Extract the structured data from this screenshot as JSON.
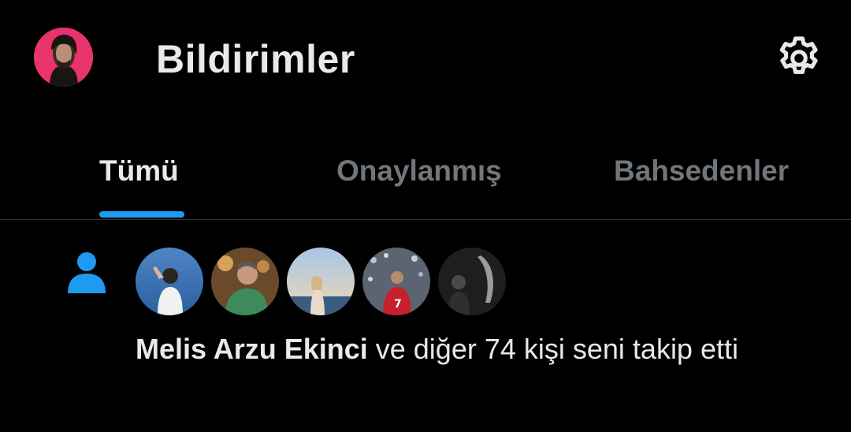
{
  "header": {
    "title": "Bildirimler",
    "avatar_icon": "profile-avatar",
    "settings_icon": "gear-icon"
  },
  "tabs": [
    {
      "label": "Tümü",
      "active": true
    },
    {
      "label": "Onaylanmış",
      "active": false
    },
    {
      "label": "Bahsedenler",
      "active": false
    }
  ],
  "notification": {
    "type_icon": "person-icon",
    "actor_name": "Melis Arzu Ekinci",
    "message": " ve diğer 74 kişi seni takip etti"
  },
  "colors": {
    "background": "#000000",
    "accent": "#1d9bf0",
    "text_primary": "#e7e9ea",
    "text_secondary": "#71767b",
    "divider": "#2f3336",
    "avatar_ring": "#e8336b"
  }
}
